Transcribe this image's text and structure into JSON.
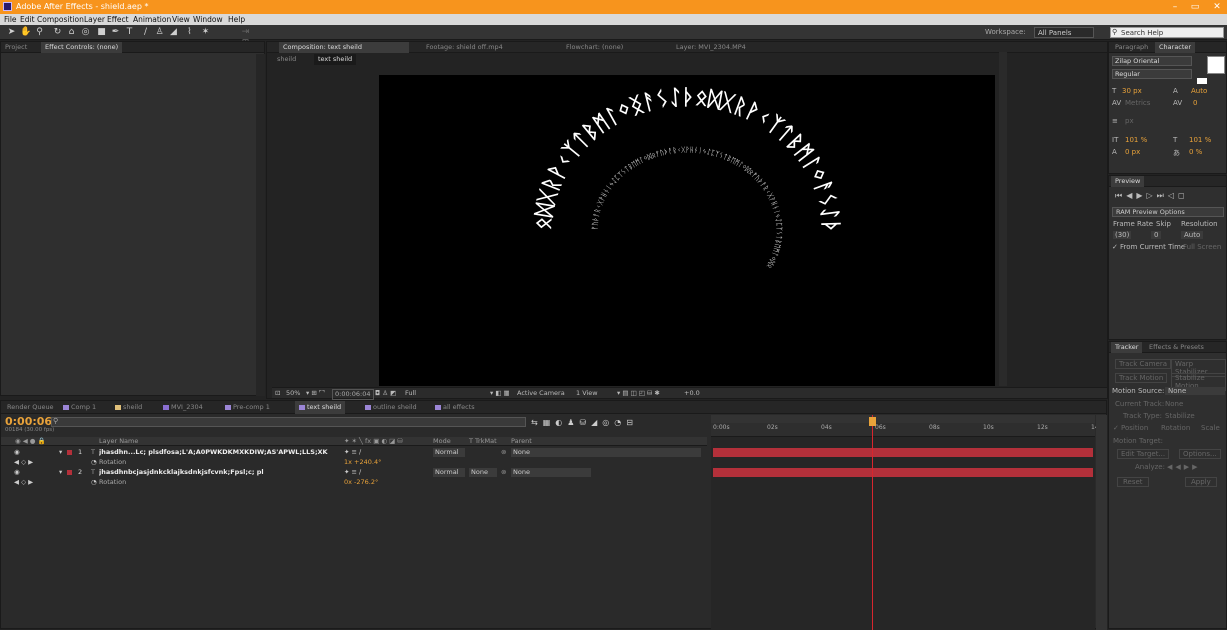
{
  "app": {
    "title": "Adobe After Effects - shield.aep *",
    "icon_label": "Ae",
    "min": "–",
    "max": "▭",
    "close": "✕"
  },
  "menu": [
    "File",
    "Edit",
    "Composition",
    "Layer",
    "Effect",
    "Animation",
    "View",
    "Window",
    "Help"
  ],
  "workspace": {
    "label": "Workspace:",
    "value": "All Panels"
  },
  "search": {
    "placeholder": "Search Help"
  },
  "project_panel": {
    "tabs": [
      "Project",
      "Effect Controls: (none)"
    ]
  },
  "viewer": {
    "tabs": [
      "Composition: text sheild",
      "Footage: shield off.mp4",
      "Flowchart: (none)",
      "Layer: MVI_2304.MP4"
    ],
    "subtabs": [
      "sheild",
      "text sheild"
    ],
    "outer_ring": "ᛟᛞᚷᚱᚹᚲᛉᛏᛒᛗᛚᛜᛝᚨᛊᛇᚦᛟᛞᚷᚱᚹᚲᛉᛏᛒᛗᛚᛜᚨᛊᛇᚦ",
    "inner_ring": "ᚠᚢᚦᚨᚱᚲᚷᚹᚺᚾᛁᛃᛇᛈᛉᛊᛏᛒᛖᛗᛚᛜᛞᛟᚠᚢᚦᚨᚱᚲᚷᚹᚺᚾᛁᛃᛇᛈᛉᛊᛏᛒᛖᛗᛚᛜᛞᛟᚠᚢᚦᚨᚱᚲᚷᚹᚺᚾᛁᛃᛇᛈᛉᛊᛏᛒᛖᛗᛚᛜᛞᛟ"
  },
  "viewer_footer": {
    "zoom": "50%",
    "time": "0:00:06:04",
    "resolution": "Full",
    "camera": "Active Camera",
    "views": "1 View",
    "exposure": "+0.0"
  },
  "right_panels": {
    "char_tabs": [
      "Paragraph",
      "Character"
    ],
    "font": "Zilap Oriental",
    "style": "Regular",
    "size": "30 px",
    "leading": "Auto",
    "kerning": "Metrics",
    "tracking": "0",
    "stroke": "px",
    "vscale": "101 %",
    "hscale": "101 %",
    "baseline": "0 px",
    "tsume": "0 %",
    "preview_tab": "Preview",
    "ram_preview": "RAM Preview Options",
    "frame_rate_label": "Frame Rate",
    "skip_label": "Skip",
    "res_label": "Resolution",
    "frame_rate": "(30)",
    "skip": "0",
    "res": "Auto",
    "from_current": "From Current Time",
    "full_screen": "Full Screen",
    "tracker_tabs": [
      "Tracker",
      "Effects & Presets"
    ],
    "track_camera": "Track Camera",
    "warp_stab": "Warp Stabilizer",
    "track_motion": "Track Motion",
    "stabilize": "Stabilize Motion",
    "motion_source_label": "Motion Source:",
    "motion_source": "None",
    "current_track": "Current Track:",
    "current_track_val": "None",
    "track_type": "Track Type:",
    "track_type_val": "Stabilize",
    "position": "Position",
    "rotation": "Rotation",
    "scale": "Scale",
    "motion_target": "Motion Target:",
    "edit_target": "Edit Target...",
    "options": "Options...",
    "analyze": "Analyze:",
    "reset": "Reset",
    "apply": "Apply"
  },
  "timeline": {
    "tabs": [
      "Render Queue",
      "Comp 1",
      "sheild",
      "MVI_2304",
      "Pre-comp 1",
      "text sheild",
      "outline sheild",
      "all effects"
    ],
    "tab_colors": [
      "#2a2a2a",
      "#9b85d6",
      "#e0c07a",
      "#8a6fd1",
      "#9b85d6",
      "#9b85d6",
      "#9b85d6",
      "#9b85d6"
    ],
    "current_time": "0:00:06:04",
    "fps": "00184 (30.00 fps)",
    "col_layer": "Layer Name",
    "col_mode": "Mode",
    "col_trkmat": "T TrkMat",
    "col_parent": "Parent",
    "ruler": [
      "0:00s",
      "02s",
      "04s",
      "06s",
      "08s",
      "10s",
      "12s",
      "14s"
    ],
    "playhead_seconds": 6.13,
    "duration_seconds": 14.6,
    "layers": [
      {
        "num": "1",
        "name": "jhasdhn...Lc; plsdfosa;L'A;A0PWKDKMXKDIW;AS'APWL;LLS;XK",
        "mode": "Normal",
        "trkmat": "",
        "parent": "None",
        "prop": "Rotation",
        "prop_val": "1x +240.4°"
      },
      {
        "num": "2",
        "name": "jhasdhnbcjasjdnkcklajksdnkjsfcvnk;Fpsl;c; pl",
        "mode": "Normal",
        "trkmat": "None",
        "parent": "None",
        "prop": "Rotation",
        "prop_val": "0x -276.2°"
      }
    ],
    "accent": "#b3303a"
  }
}
